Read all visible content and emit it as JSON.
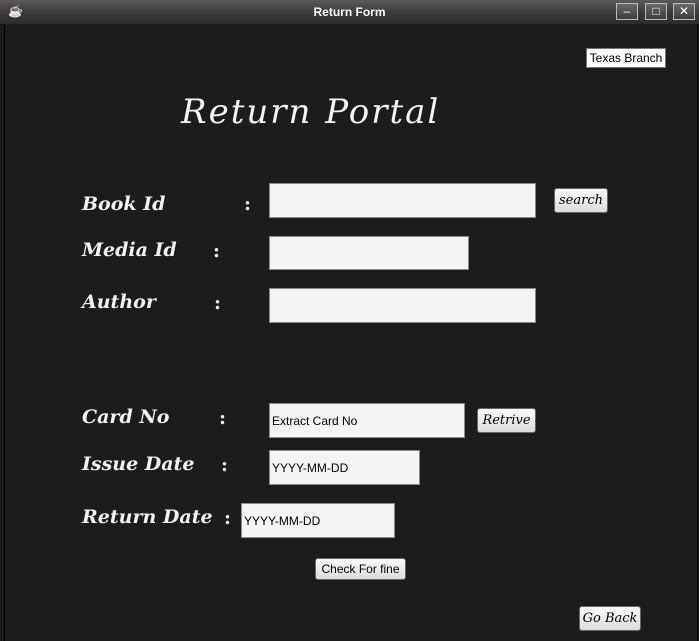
{
  "window": {
    "title": "Return Form",
    "app_icon": "coffee-cup-icon",
    "controls": {
      "minimize": "–",
      "maximize": "□",
      "close": "✕"
    }
  },
  "header": {
    "branch": "Texas Branch",
    "title": "Return Portal"
  },
  "form": {
    "book_id": {
      "label": "Book Id",
      "colon": ":",
      "value": ""
    },
    "media_id": {
      "label": "Media Id",
      "colon": ":",
      "value": ""
    },
    "author": {
      "label": "Author",
      "colon": ":",
      "value": ""
    },
    "card_no": {
      "label": "Card No",
      "colon": ":",
      "value": "Extract Card No"
    },
    "issue_date": {
      "label": "Issue Date",
      "colon": ":",
      "value": "YYYY-MM-DD"
    },
    "return_date": {
      "label": "Return Date",
      "colon": ":",
      "value": "YYYY-MM-DD"
    }
  },
  "buttons": {
    "search": "search",
    "retrive": "Retrive",
    "check_fine": "Check For fine",
    "go_back": "Go Back"
  }
}
